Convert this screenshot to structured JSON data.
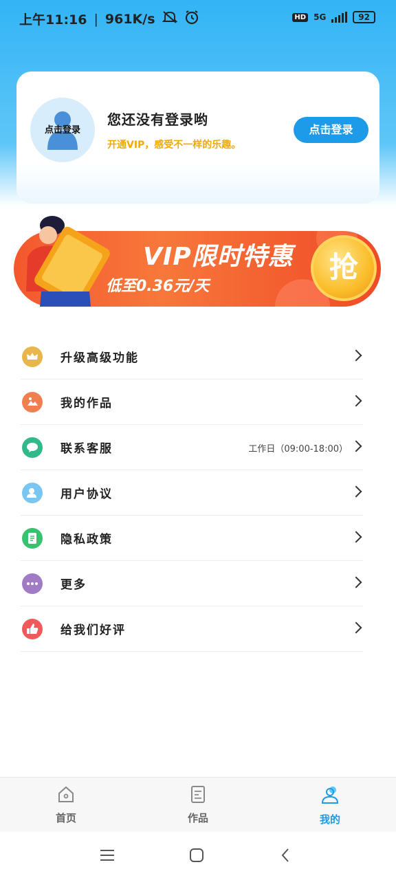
{
  "status_bar": {
    "time": "上午11:16",
    "speed": "961K/s",
    "hd": "HD",
    "network": "5G",
    "battery": "92"
  },
  "profile": {
    "avatar_label": "点击登录",
    "greeting": "您还没有登录哟",
    "subtitle": "开通VIP，感受不一样的乐趣。",
    "login_button": "点击登录"
  },
  "vip_banner": {
    "title": "VIP限时特惠",
    "subtitle": "低至0.36元/天",
    "button": "抢"
  },
  "menu": [
    {
      "label": "升级高级功能",
      "extra": "",
      "icon": "crown-icon",
      "color": "#e8b64a"
    },
    {
      "label": "我的作品",
      "extra": "",
      "icon": "picture-icon",
      "color": "#ef7f4f"
    },
    {
      "label": "联系客服",
      "extra": "工作日（09:00-18:00）",
      "icon": "chat-icon",
      "color": "#32b98a"
    },
    {
      "label": "用户协议",
      "extra": "",
      "icon": "user-icon",
      "color": "#79c6f3"
    },
    {
      "label": "隐私政策",
      "extra": "",
      "icon": "document-icon",
      "color": "#36c26f"
    },
    {
      "label": "更多",
      "extra": "",
      "icon": "more-icon",
      "color": "#a17bc4"
    },
    {
      "label": "给我们好评",
      "extra": "",
      "icon": "thumbs-up-icon",
      "color": "#ef5a5a"
    }
  ],
  "tabbar": {
    "home": "首页",
    "works": "作品",
    "mine": "我的",
    "active_color": "#1e9be8"
  }
}
